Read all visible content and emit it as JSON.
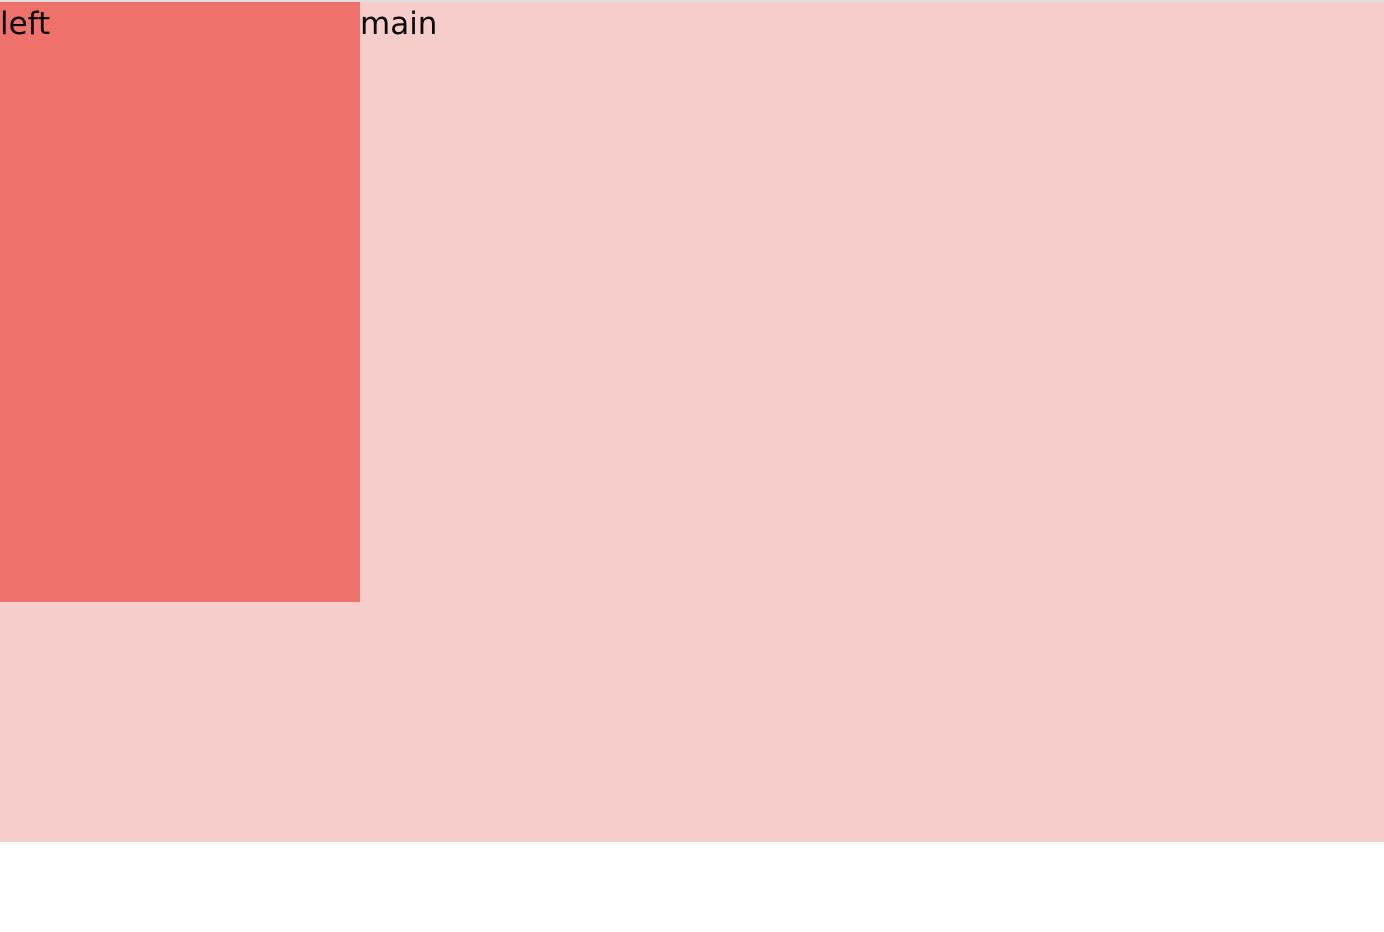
{
  "layout": {
    "left_label": "left",
    "main_label": "main"
  },
  "colors": {
    "container_bg": "#f7cdcc",
    "left_bg": "#ee716b",
    "page_bg": "#ffffff",
    "top_rule": "#dedede"
  }
}
